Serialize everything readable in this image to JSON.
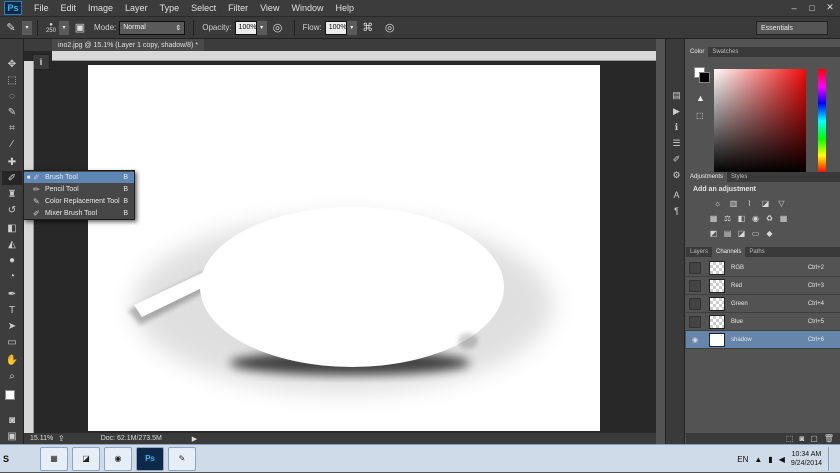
{
  "app": {
    "logo": "Ps"
  },
  "menu": [
    "File",
    "Edit",
    "Image",
    "Layer",
    "Type",
    "Select",
    "Filter",
    "View",
    "Window",
    "Help"
  ],
  "window_controls": [
    "–",
    "□",
    "✕"
  ],
  "options": {
    "brush_size": "250",
    "mode_label": "Mode:",
    "mode_value": "Normal",
    "opacity_label": "Opacity:",
    "opacity_value": "100%",
    "flow_label": "Flow:",
    "flow_value": "100%",
    "workspace": "Essentials"
  },
  "document": {
    "tab_title": "ino2.jpg @ 15.1% (Layer 1 copy, shadow/8) *",
    "zoom": "15.11%",
    "doc_size": "Doc: 62.1M/273.5M"
  },
  "tool_flyout": [
    {
      "label": "Brush Tool",
      "key": "B",
      "selected": true
    },
    {
      "label": "Pencil Tool",
      "key": "B",
      "selected": false
    },
    {
      "label": "Color Replacement Tool",
      "key": "B",
      "selected": false
    },
    {
      "label": "Mixer Brush Tool",
      "key": "B",
      "selected": false
    }
  ],
  "panels": {
    "color_tabs": [
      "Color",
      "Swatches"
    ],
    "adjust_tabs": [
      "Adjustments",
      "Styles"
    ],
    "adjust_title": "Add an adjustment",
    "layer_tabs": [
      "Layers",
      "Channels",
      "Paths"
    ]
  },
  "channels": [
    {
      "name": "RGB",
      "shortcut": "Ctrl+2",
      "selected": false
    },
    {
      "name": "Red",
      "shortcut": "Ctrl+3",
      "selected": false
    },
    {
      "name": "Green",
      "shortcut": "Ctrl+4",
      "selected": false
    },
    {
      "name": "Blue",
      "shortcut": "Ctrl+5",
      "selected": false
    },
    {
      "name": "shadow",
      "shortcut": "Ctrl+6",
      "selected": true
    }
  ],
  "taskbar": {
    "start": "S",
    "lang": "EN",
    "time": "10:34 AM",
    "date": "9/24/2014"
  },
  "colors": {
    "accent": "#5e86b5",
    "selected_channel": "#6585aa",
    "foreground": "#ffffff",
    "background": "#000000"
  }
}
